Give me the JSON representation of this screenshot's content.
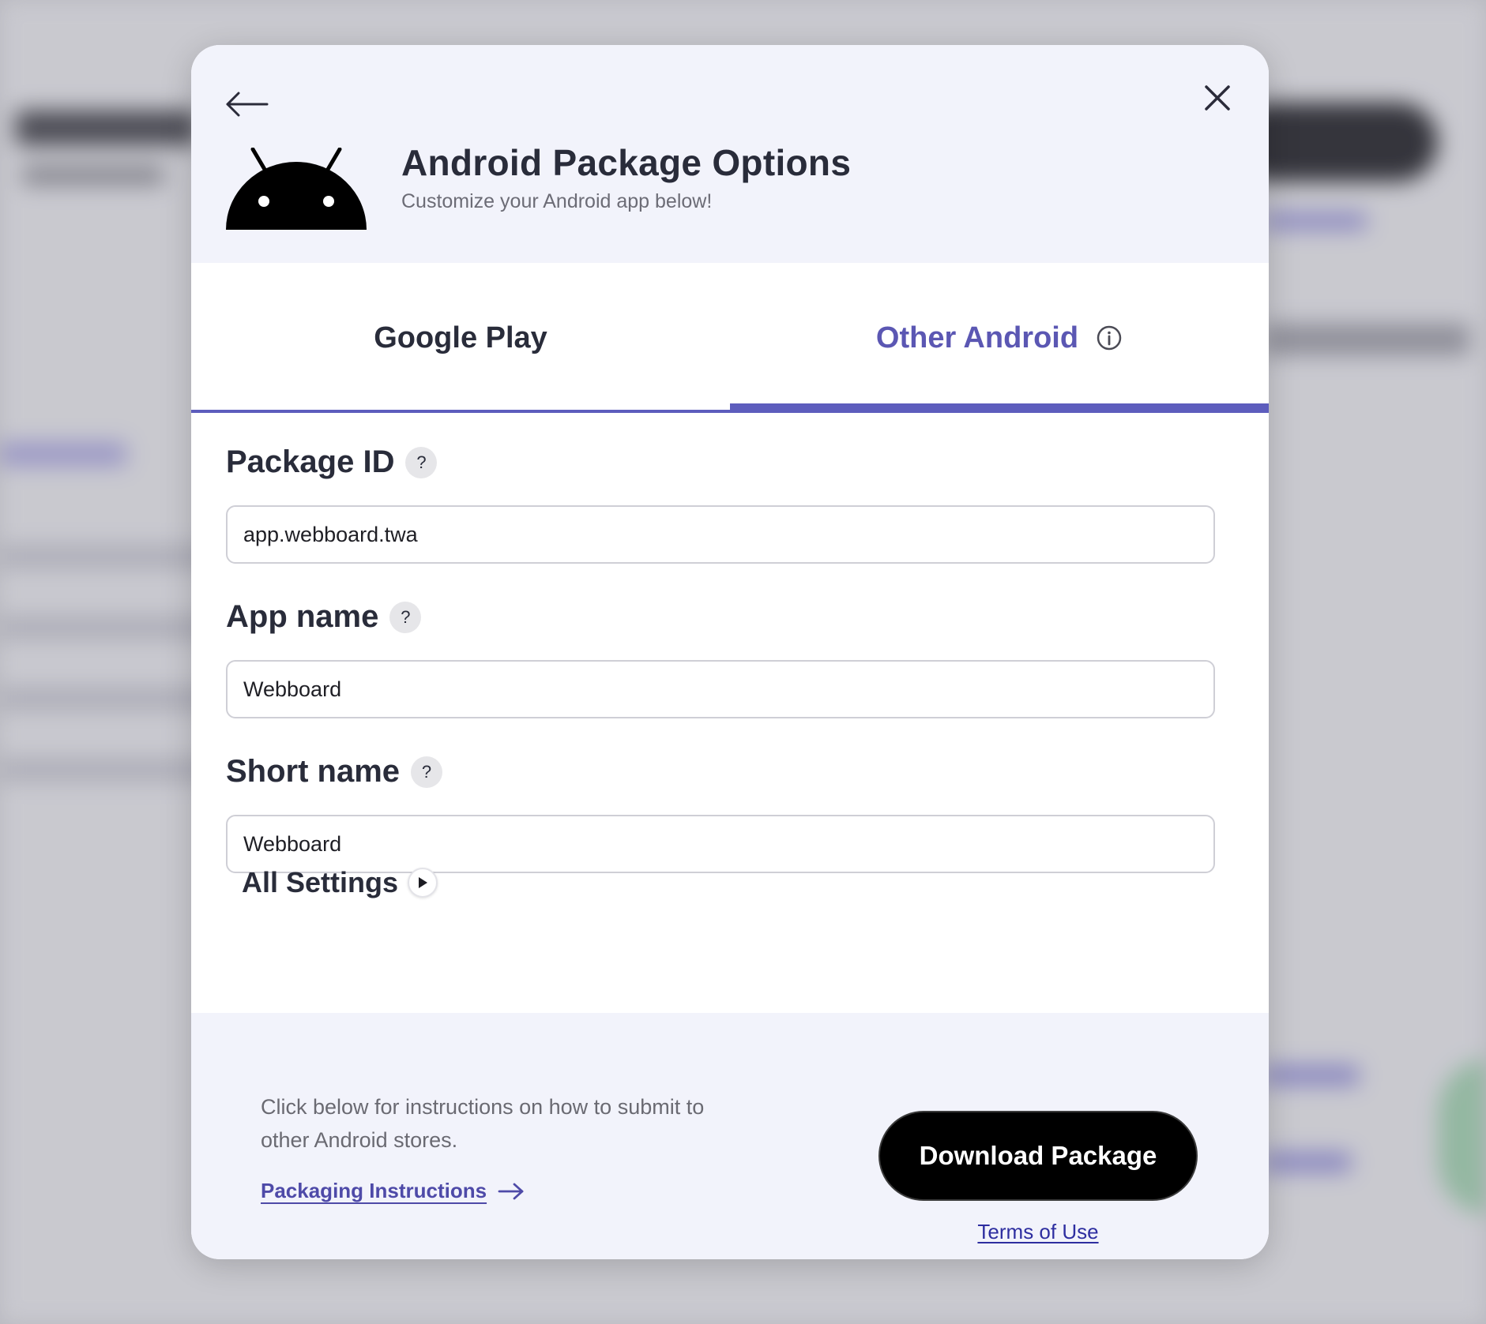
{
  "background": {
    "accent": "#5d5dbd",
    "dark": "#1c1c22"
  },
  "header": {
    "back_icon": "arrow-left-icon",
    "close_icon": "close-icon",
    "logo_icon": "android-logo-icon",
    "title": "Android Package Options",
    "subtitle": "Customize your Android app below!"
  },
  "tabs": [
    {
      "label": "Google Play",
      "active": false
    },
    {
      "label": "Other Android",
      "active": true,
      "icon": "info-icon"
    }
  ],
  "form": {
    "package_id": {
      "label": "Package ID",
      "help": "?",
      "value": "app.webboard.twa"
    },
    "app_name": {
      "label": "App name",
      "help": "?",
      "value": "Webboard"
    },
    "short_name": {
      "label": "Short name",
      "help": "?",
      "value": "Webboard"
    },
    "all_settings": {
      "label": "All Settings",
      "icon": "play-triangle-icon"
    }
  },
  "footer": {
    "description": "Click below for instructions on how to submit to other Android stores.",
    "packaging_link": "Packaging Instructions",
    "download_button": "Download Package",
    "terms_link": "Terms of Use"
  },
  "colors": {
    "accent": "#5d5dbd",
    "title_text": "#292c3a",
    "header_bg": "#f2f3fb",
    "button_bg": "#000000"
  }
}
